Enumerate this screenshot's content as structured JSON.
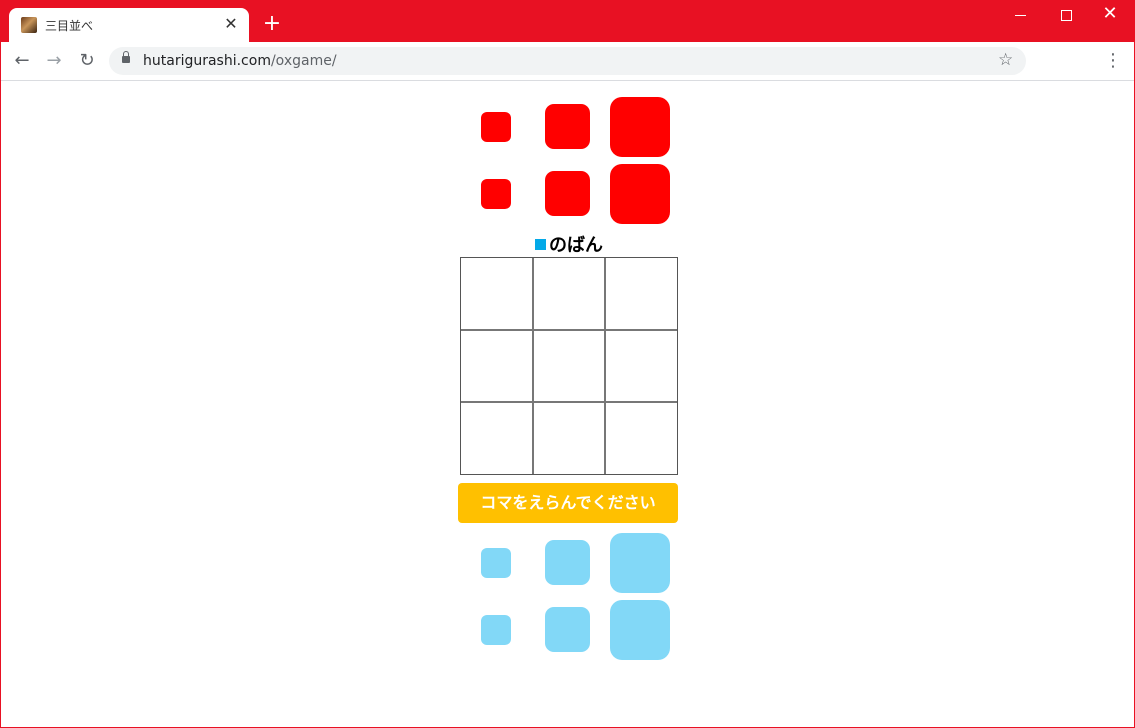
{
  "browser": {
    "tab_title": "三目並べ",
    "tab_close": "✕",
    "new_tab": "+",
    "url_host": "hutarigurashi.com",
    "url_path": "/oxgame/",
    "back_icon": "←",
    "forward_icon": "→",
    "reload_icon": "↻",
    "star_icon": "☆",
    "menu_icon": "⋮",
    "close_icon": "✕",
    "accent_color": "#e81123"
  },
  "game": {
    "turn_label": "のばん",
    "turn_color": "#03a9e8",
    "action_label": "コマをえらんでください",
    "action_color": "#ffc000",
    "red_pieces": [
      "small",
      "medium",
      "large",
      "small",
      "medium",
      "large"
    ],
    "blue_pieces": [
      "small",
      "medium",
      "large",
      "small",
      "medium",
      "large"
    ],
    "red_color": "#ff0000",
    "blue_color": "#82d8f7",
    "board_cells": [
      "",
      "",
      "",
      "",
      "",
      "",
      "",
      "",
      ""
    ]
  }
}
